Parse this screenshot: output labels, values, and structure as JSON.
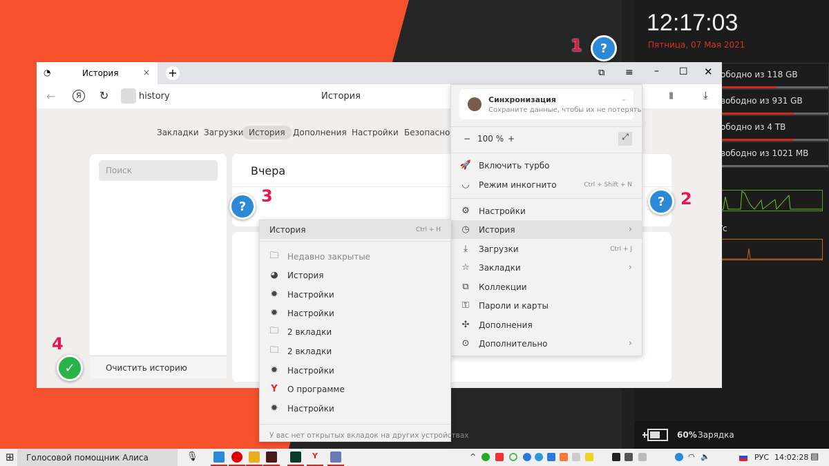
{
  "widget": {
    "clock": "12:17:03",
    "date": "Пятница, 07 Мая 2021",
    "disks": [
      {
        "label": "ободно из 118 GB",
        "used": 0.51
      },
      {
        "label": "вободно из 931 GB",
        "used": 0.7
      },
      {
        "label": "ободно из 4 TB",
        "used": 0.7
      },
      {
        "label": "вободно из 1021 MB",
        "used": 0
      }
    ],
    "net_label": "/с",
    "battery": {
      "percent_label": "60%",
      "status": "Зарядка",
      "level": 0.6
    }
  },
  "browser": {
    "tab_title": "История",
    "url": "history",
    "page_title": "История",
    "nav": [
      "Закладки",
      "Загрузки",
      "История",
      "Дополнения",
      "Настройки",
      "Безопасность"
    ],
    "search_placeholder": "Поиск",
    "section_title": "Вчера",
    "clear_history": "Очистить историю"
  },
  "menu": {
    "sync_title": "Синхронизация",
    "sync_subtitle": "Сохраните данные, чтобы их не потерять",
    "zoom": "100 %",
    "zoom_minus": "−",
    "zoom_plus": "+",
    "items": [
      {
        "label": "Включить турбо",
        "icon": "rocket-icon"
      },
      {
        "label": "Режим инкогнито",
        "shortcut": "Ctrl + Shift + N",
        "icon": "incognito-mask-icon"
      },
      {
        "label": "Настройки",
        "icon": "gear-icon"
      },
      {
        "label": "История",
        "icon": "clock-icon"
      },
      {
        "label": "Загрузки",
        "shortcut": "Ctrl + J",
        "icon": "download-icon"
      },
      {
        "label": "Закладки",
        "icon": "star-icon"
      },
      {
        "label": "Коллекции",
        "icon": "collections-icon"
      },
      {
        "label": "Пароли и карты",
        "icon": "key-icon"
      },
      {
        "label": "Дополнения",
        "icon": "puzzle-icon"
      },
      {
        "label": "Дополнительно",
        "icon": "more-icon"
      }
    ]
  },
  "submenu": {
    "header": "История",
    "header_shortcut": "Ctrl + H",
    "items": [
      {
        "label": "Недавно закрытые",
        "icon": "folder-icon"
      },
      {
        "label": "История",
        "icon": "clock-icon"
      },
      {
        "label": "Настройки",
        "icon": "gear-icon"
      },
      {
        "label": "Настройки",
        "icon": "gear-icon"
      },
      {
        "label": "2 вкладки",
        "icon": "folder-icon"
      },
      {
        "label": "2 вкладки",
        "icon": "folder-icon"
      },
      {
        "label": "Настройки",
        "icon": "gear-icon"
      },
      {
        "label": "О программе",
        "icon": "yandex-icon"
      },
      {
        "label": "Настройки",
        "icon": "gear-icon"
      }
    ],
    "footer": "У вас нет открытых вкладок на других устройствах"
  },
  "callouts": [
    {
      "num": "1",
      "symbol": "?"
    },
    {
      "num": "2",
      "symbol": "?"
    },
    {
      "num": "3",
      "symbol": "?"
    },
    {
      "num": "4",
      "symbol": "✓"
    }
  ],
  "taskbar": {
    "search": "Голосовой помощник Алиса",
    "lang": "РУС",
    "time": "14:02:28"
  },
  "colors": {
    "accent_orange": "#f4512c",
    "callout_blue": "#2a8ad8",
    "callout_green": "#27b34a",
    "number_red": "#e8164c"
  }
}
